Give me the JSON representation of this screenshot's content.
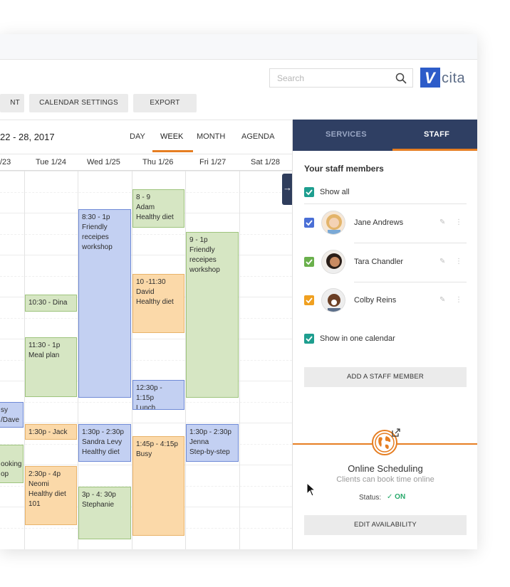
{
  "search": {
    "placeholder": "Search"
  },
  "logo": {
    "mark": "V",
    "word": "cita"
  },
  "toolbar": {
    "left_button": "NT",
    "calendar_settings": "CALENDAR SETTINGS",
    "export": "EXPORT"
  },
  "calendar": {
    "date_range": "22 - 28, 2017",
    "views": [
      "DAY",
      "WEEK",
      "MONTH",
      "AGENDA"
    ],
    "active_view": "WEEK",
    "days": [
      "/23",
      "Tue 1/24",
      "Wed 1/25",
      "Thu 1/26",
      "Fri 1/27",
      "Sat 1/28"
    ],
    "events": [
      {
        "time": "8 - 9",
        "line1": "Adam",
        "line2": "Healthy diet",
        "color": "green"
      },
      {
        "time": "8:30 - 1p",
        "line1": "Friendly",
        "line2": "receipes",
        "line3": "workshop",
        "color": "blue"
      },
      {
        "time": "9 - 1p",
        "line1": "Friendly",
        "line2": "receipes",
        "line3": "workshop",
        "color": "green"
      },
      {
        "time": "10 -11:30",
        "line1": "David",
        "line2": "Healthy diet",
        "color": "orange"
      },
      {
        "time": "10:30 - Dina",
        "color": "green"
      },
      {
        "time": "11:30 - 1p",
        "line1": "Meal plan",
        "color": "green"
      },
      {
        "time": "12:30p - 1:15p",
        "line1": "Lunch",
        "color": "blue"
      },
      {
        "line1": "sy",
        "line2": "/Dave",
        "color": "blue"
      },
      {
        "time": "1:30p - Jack",
        "color": "orange"
      },
      {
        "time": "1:30p - 2:30p",
        "line1": "Sandra Levy",
        "line2": "Healthy diet",
        "color": "blue"
      },
      {
        "time": "1:30p - 2:30p",
        "line1": "Jenna",
        "line2": "Step-by-step",
        "color": "blue"
      },
      {
        "time": "1:45p - 4:15p",
        "line1": "Busy",
        "color": "orange"
      },
      {
        "line1": "ooking",
        "line2": "op",
        "color": "green"
      },
      {
        "time": "2:30p - 4p",
        "line1": "Neomi",
        "line2": "Healthy diet",
        "line3": "101",
        "color": "orange"
      },
      {
        "time": "3p - 4: 30p",
        "line1": "Stephanie",
        "color": "green"
      }
    ]
  },
  "panel": {
    "tabs": {
      "services": "SERVICES",
      "staff": "STAFF"
    },
    "heading": "Your staff members",
    "show_all": "Show all",
    "staff": [
      {
        "name": "Jane Andrews",
        "color": "#4a6fd6"
      },
      {
        "name": "Tara Chandler",
        "color": "#6ab04c"
      },
      {
        "name": "Colby Reins",
        "color": "#f0a020"
      }
    ],
    "show_in_one_calendar": "Show in one calendar",
    "add_staff": "ADD A STAFF MEMBER",
    "online_scheduling": {
      "title": "Online Scheduling",
      "subtitle": "Clients can book time online",
      "status_label": "Status:",
      "status_value": "ON"
    },
    "edit_availability": "EDIT AVAILABILITY"
  },
  "colors": {
    "accent": "#e67e22",
    "tabbar": "#2f3f63",
    "check_teal": "#1e9e8f"
  }
}
